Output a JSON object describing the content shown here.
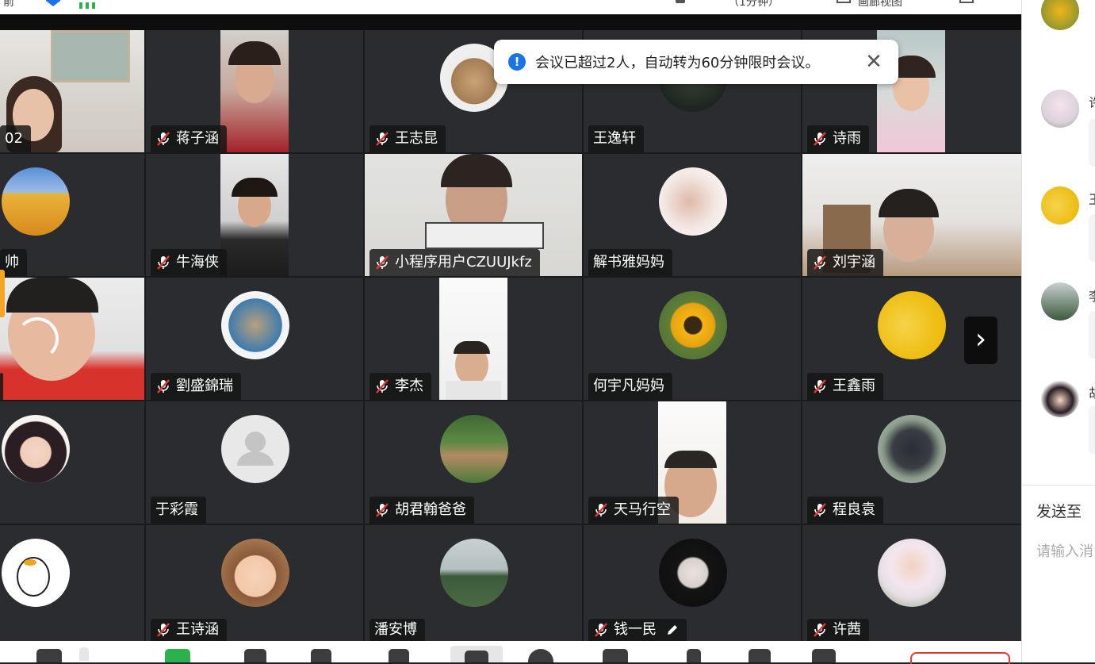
{
  "topbar": {
    "fragment_left": "前",
    "fragment_timer": "（1分钟）",
    "fragment_view": "画廊视图"
  },
  "toast": {
    "message": "会议已超过2人，自动转为60分钟限时会议。"
  },
  "participants": [
    {
      "name": "02",
      "muted": false
    },
    {
      "name": "蒋子涵",
      "muted": true
    },
    {
      "name": "王志昆",
      "muted": true
    },
    {
      "name": "王逸轩",
      "muted": false
    },
    {
      "name": "诗雨",
      "muted": true
    },
    {
      "name": "帅",
      "muted": false
    },
    {
      "name": "牛海侠",
      "muted": true
    },
    {
      "name": "小程序用户CZUUJkfz",
      "muted": true
    },
    {
      "name": "解书雅妈妈",
      "muted": false
    },
    {
      "name": "刘宇涵",
      "muted": true
    },
    {
      "name": "",
      "muted": false
    },
    {
      "name": "劉盛錦瑞",
      "muted": true
    },
    {
      "name": "李杰",
      "muted": true
    },
    {
      "name": "何宇凡妈妈",
      "muted": false
    },
    {
      "name": "王鑫雨",
      "muted": true
    },
    {
      "name": "",
      "muted": false
    },
    {
      "name": "于彩霞",
      "muted": false
    },
    {
      "name": "胡君翰爸爸",
      "muted": true
    },
    {
      "name": "天马行空",
      "muted": true
    },
    {
      "name": "程良袁",
      "muted": true
    },
    {
      "name": "",
      "muted": false
    },
    {
      "name": "王诗涵",
      "muted": true
    },
    {
      "name": "潘安博",
      "muted": false
    },
    {
      "name": "钱一民",
      "muted": true
    },
    {
      "name": "许茜",
      "muted": true
    }
  ],
  "chat": {
    "names": [
      "许",
      "王",
      "李",
      "胡"
    ],
    "send_to_label": "发送至",
    "input_placeholder": "请输入消"
  },
  "colors": {
    "accent_blue": "#1a73e8",
    "tile_bg": "#2a2c2f",
    "grid_bg": "#1a1b1d"
  }
}
